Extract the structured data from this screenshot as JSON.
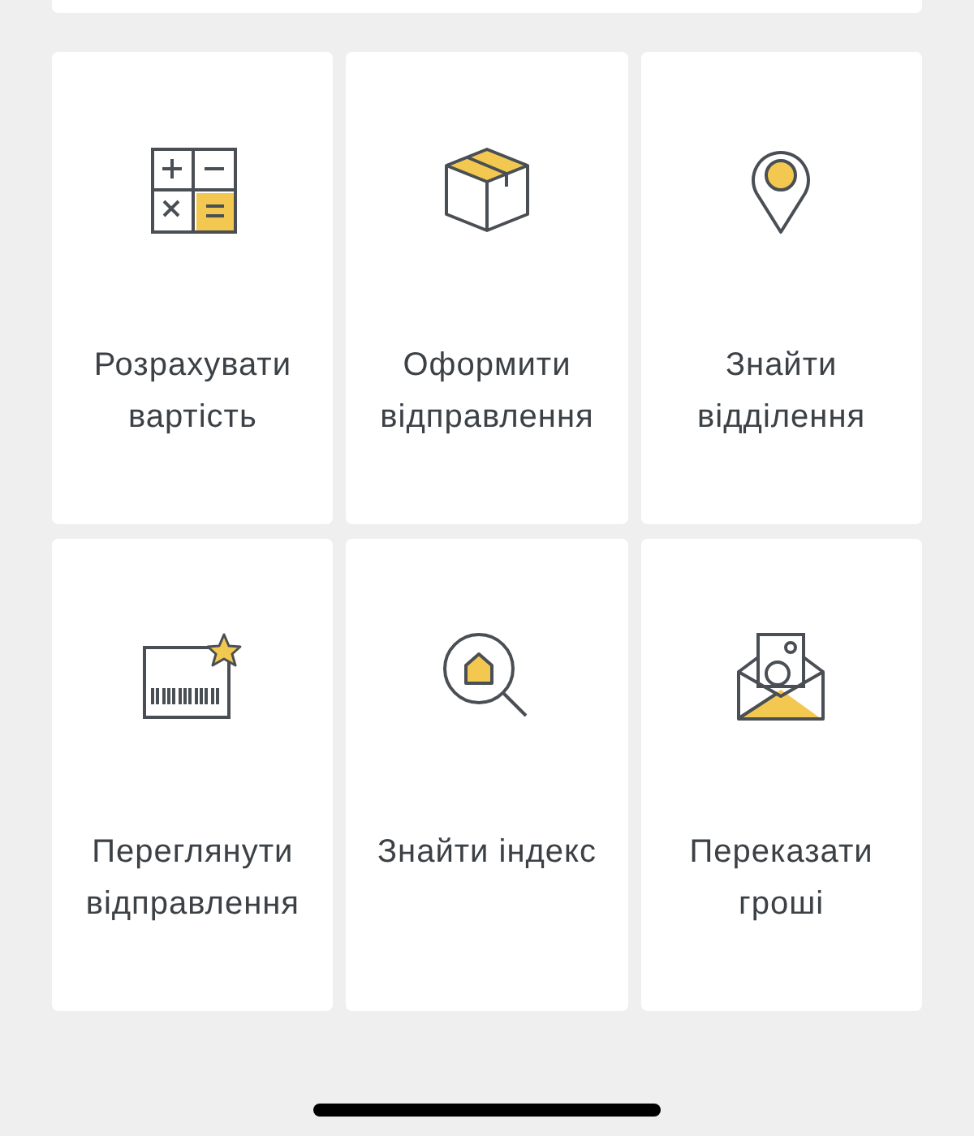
{
  "actions": [
    {
      "kind": "calculator",
      "label": "Розрахувати вартість"
    },
    {
      "kind": "box",
      "label": "Оформити відправлення"
    },
    {
      "kind": "pin",
      "label": "Знайти відділення"
    },
    {
      "kind": "barcode",
      "label": "Переглянути відправлення"
    },
    {
      "kind": "search-home",
      "label": "Знайти індекс"
    },
    {
      "kind": "envelope",
      "label": "Переказати гроші"
    }
  ]
}
